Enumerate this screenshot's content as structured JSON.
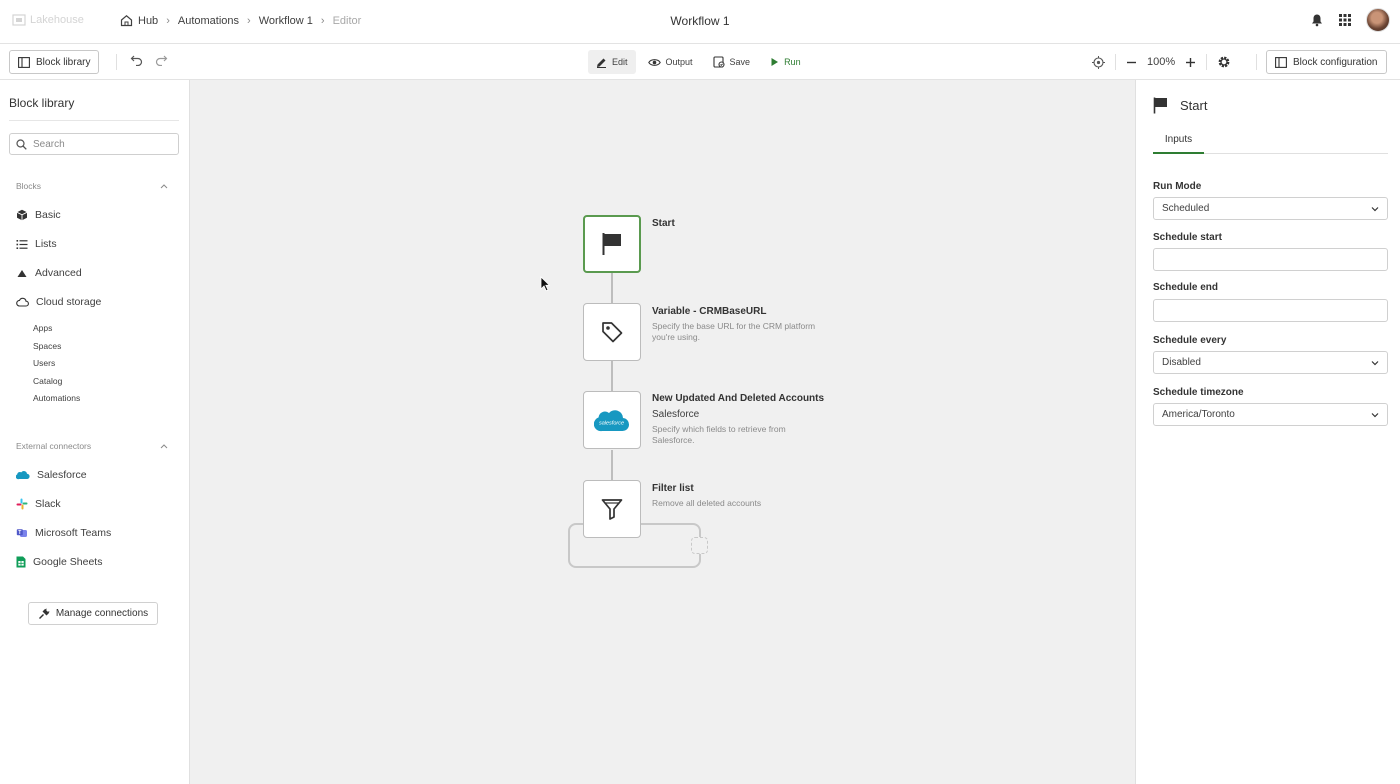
{
  "header": {
    "logo_text": "Lakehouse",
    "breadcrumb": [
      "Hub",
      "Automations",
      "Workflow 1",
      "Editor"
    ],
    "title": "Workflow 1"
  },
  "toolbar": {
    "block_library_label": "Block library",
    "modes": [
      "Edit",
      "Output",
      "Save",
      "Run"
    ],
    "zoom": "100%",
    "block_configuration_label": "Block configuration"
  },
  "sidebar": {
    "title": "Block library",
    "search_placeholder": "Search",
    "blocks_section": "Blocks",
    "blocks": [
      "Basic",
      "Lists",
      "Advanced",
      "Cloud storage"
    ],
    "sub_items": [
      "Apps",
      "Spaces",
      "Users",
      "Catalog",
      "Automations"
    ],
    "external_section": "External connectors",
    "connectors": [
      "Salesforce",
      "Slack",
      "Microsoft Teams",
      "Google Sheets"
    ],
    "manage_label": "Manage connections"
  },
  "workflow": {
    "nodes": [
      {
        "title": "Start",
        "subtitle": "",
        "description": "",
        "icon": "flag-icon"
      },
      {
        "title": "Variable - CRMBaseURL",
        "subtitle": "",
        "description": "Specify the base URL for the CRM platform you're using.",
        "icon": "tag-icon"
      },
      {
        "title": "New Updated And Deleted Accounts",
        "subtitle": "Salesforce",
        "description": "Specify which fields to retrieve from Salesforce.",
        "icon": "salesforce-icon",
        "icon_text": "salesforce"
      },
      {
        "title": "Filter list",
        "subtitle": "",
        "description": "Remove all deleted accounts",
        "icon": "filter-icon"
      }
    ]
  },
  "config": {
    "title": "Start",
    "tab": "Inputs",
    "fields": [
      {
        "label": "Run Mode",
        "value": "Scheduled",
        "type": "select"
      },
      {
        "label": "Schedule start",
        "value": "",
        "type": "input"
      },
      {
        "label": "Schedule end",
        "value": "",
        "type": "input"
      },
      {
        "label": "Schedule every",
        "value": "Disabled",
        "type": "select"
      },
      {
        "label": "Schedule timezone",
        "value": "America/Toronto",
        "type": "select"
      }
    ]
  },
  "colors": {
    "accent": "#2e7d32",
    "start_border": "#5a9a4f",
    "canvas": "#f0f0f0",
    "salesforce": "#1798c1"
  }
}
